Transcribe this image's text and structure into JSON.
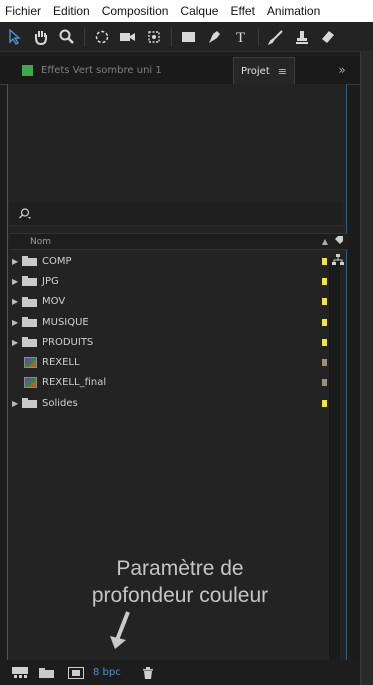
{
  "menu": [
    "Fichier",
    "Edition",
    "Composition",
    "Calque",
    "Effet",
    "Animation"
  ],
  "toolbar": {
    "tools": [
      "selection-arrow",
      "hand",
      "zoom",
      "rotate",
      "camera-orbit",
      "pan-behind",
      "rectangle",
      "pen",
      "text",
      "brush",
      "clone-stamp",
      "eraser"
    ]
  },
  "tabs": {
    "effects": "Effets  Vert sombre uni 1",
    "project": "Projet",
    "project_menu": "≡",
    "more": "»"
  },
  "project_panel": {
    "search_icon": "⌕",
    "column_name": "Nom",
    "items": [
      {
        "name": "COMP",
        "type": "folder",
        "label_color": "#f2e24a"
      },
      {
        "name": "JPG",
        "type": "folder",
        "label_color": "#f2e24a"
      },
      {
        "name": "MOV",
        "type": "folder",
        "label_color": "#f2e24a"
      },
      {
        "name": "MUSIQUE",
        "type": "folder",
        "label_color": "#f2e24a"
      },
      {
        "name": "PRODUITS",
        "type": "folder",
        "label_color": "#f2e24a"
      },
      {
        "name": "REXELL",
        "type": "composition",
        "label_color": "#9c8f7a"
      },
      {
        "name": "REXELL_final",
        "type": "composition",
        "label_color": "#9c8f7a"
      },
      {
        "name": "Solides",
        "type": "folder",
        "label_color": "#f2e24a"
      }
    ]
  },
  "annotation": {
    "line1": "Paramètre de",
    "line2": "profondeur couleur"
  },
  "footer": {
    "bpc": "8 bpc"
  },
  "colors": {
    "accent_blue": "#4e8fd2",
    "effects_tab_green": "#3da94c"
  }
}
